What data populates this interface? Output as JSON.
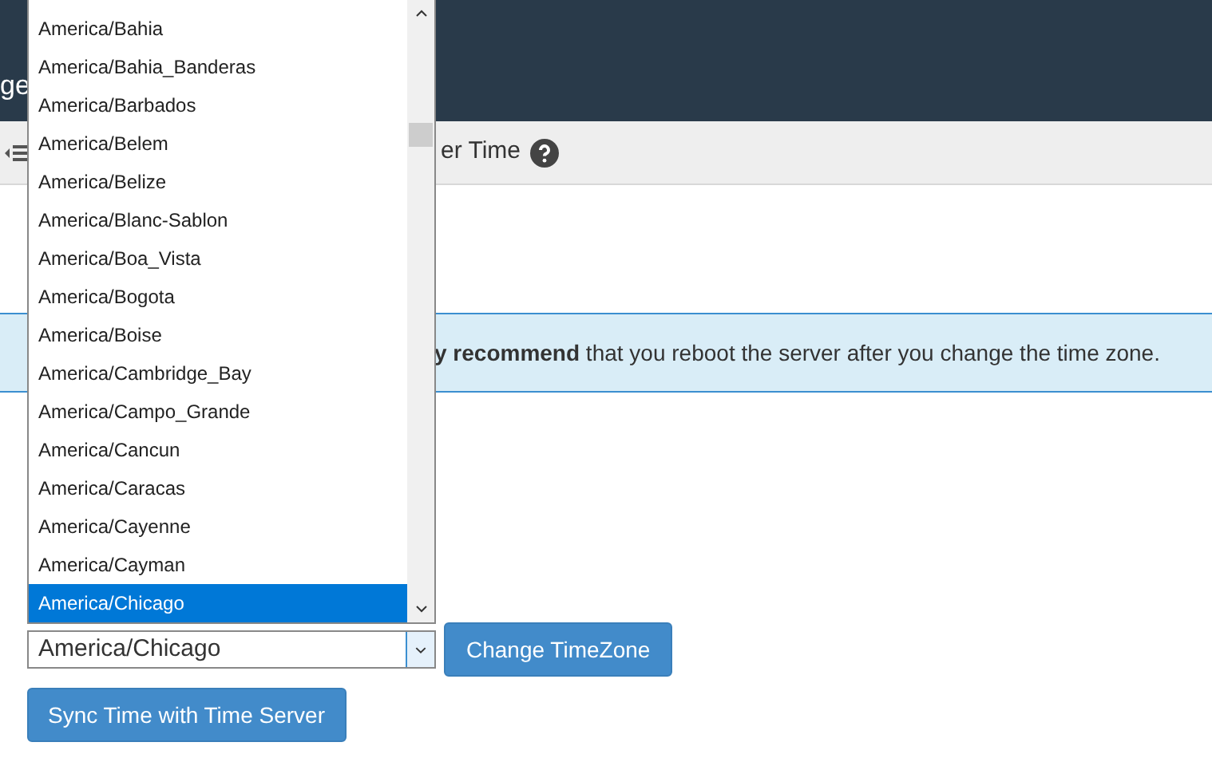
{
  "header": {
    "title": "ge"
  },
  "toolbar": {
    "title": "er Time"
  },
  "alert": {
    "text": "**y recommend** that you reboot the server after you change the time zone."
  },
  "timezone_list": [
    {
      "label": "America/Bahia",
      "selected": false
    },
    {
      "label": "America/Bahia_Banderas",
      "selected": false
    },
    {
      "label": "America/Barbados",
      "selected": false
    },
    {
      "label": "America/Belem",
      "selected": false
    },
    {
      "label": "America/Belize",
      "selected": false
    },
    {
      "label": "America/Blanc-Sablon",
      "selected": false
    },
    {
      "label": "America/Boa_Vista",
      "selected": false
    },
    {
      "label": "America/Bogota",
      "selected": false
    },
    {
      "label": "America/Boise",
      "selected": false
    },
    {
      "label": "America/Cambridge_Bay",
      "selected": false
    },
    {
      "label": "America/Campo_Grande",
      "selected": false
    },
    {
      "label": "America/Cancun",
      "selected": false
    },
    {
      "label": "America/Caracas",
      "selected": false
    },
    {
      "label": "America/Cayenne",
      "selected": false
    },
    {
      "label": "America/Cayman",
      "selected": false
    },
    {
      "label": "America/Chicago",
      "selected": true
    }
  ],
  "timezone_select": {
    "value": "America/Chicago"
  },
  "buttons": [
    {
      "label": "Change TimeZone"
    },
    {
      "label": "Sync Time with Time Server"
    }
  ]
}
